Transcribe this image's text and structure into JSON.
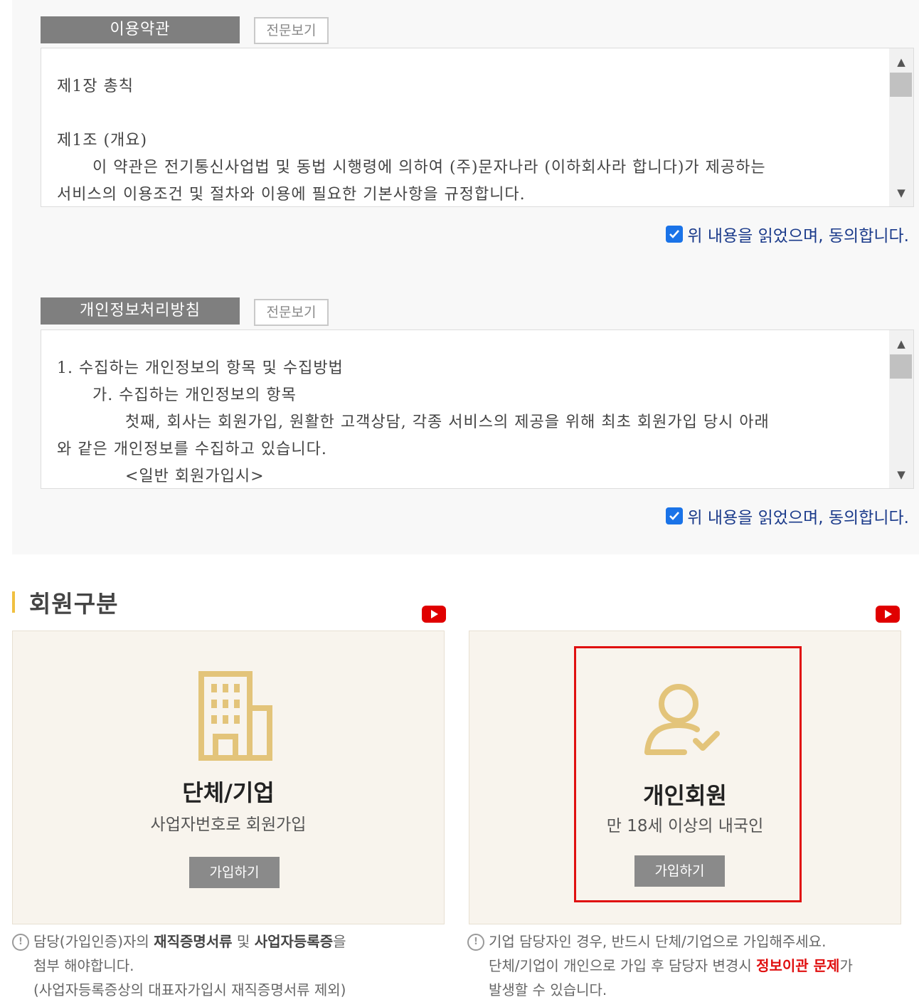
{
  "terms": {
    "title": "이용약관",
    "view_full": "전문보기",
    "lines": [
      "제1장 총칙",
      "제1조 (개요)",
      "이 약관은 전기통신사업법 및 동법 시행령에 의하여 (주)문자나라 (이하회사라 합니다)가 제공하는",
      "서비스의 이용조건 및 절차와 이용에 필요한 기본사항을 규정합니다."
    ],
    "agree": "위 내용을 읽었으며, 동의합니다."
  },
  "privacy": {
    "title": "개인정보처리방침",
    "view_full": "전문보기",
    "lines": [
      "1. 수집하는 개인정보의 항목 및 수집방법",
      "가. 수집하는 개인정보의 항목",
      "첫째, 회사는 회원가입, 원활한 고객상담, 각종 서비스의 제공을 위해 최초 회원가입 당시 아래",
      "와 같은 개인정보를 수집하고 있습니다.",
      "<일반 회원가입시>"
    ],
    "agree": "위 내용을 읽었으며, 동의합니다."
  },
  "member": {
    "title": "회원구분",
    "cards": [
      {
        "title": "단체/기업",
        "subtitle": "사업자번호로 회원가입",
        "join": "가입하기",
        "icon": "building-icon"
      },
      {
        "title": "개인회원",
        "subtitle": "만 18세 이상의 내국인",
        "join": "가입하기",
        "icon": "person-check-icon"
      }
    ],
    "notes": {
      "left": {
        "p1": "담당(가입인증)자의 ",
        "b1": "재직증명서류",
        "p2": " 및 ",
        "b2": "사업자등록증",
        "p3": "을",
        "line2": "첨부 해야합니다.",
        "line3": "(사업자등록증상의 대표자가입시 재직증명서류 제외)"
      },
      "right": {
        "line1": "기업 담당자인 경우, 반드시 단체/기업으로 가입해주세요.",
        "p1": "단체/기업이 개인으로 가입 후 담당자 변경시 ",
        "red": "정보이관 문제",
        "p2": "가",
        "line3": "발생할 수 있습니다."
      }
    }
  },
  "colors": {
    "accent": "#e01010",
    "checkbox": "#1a73e8",
    "gold": "#e3c47a"
  }
}
